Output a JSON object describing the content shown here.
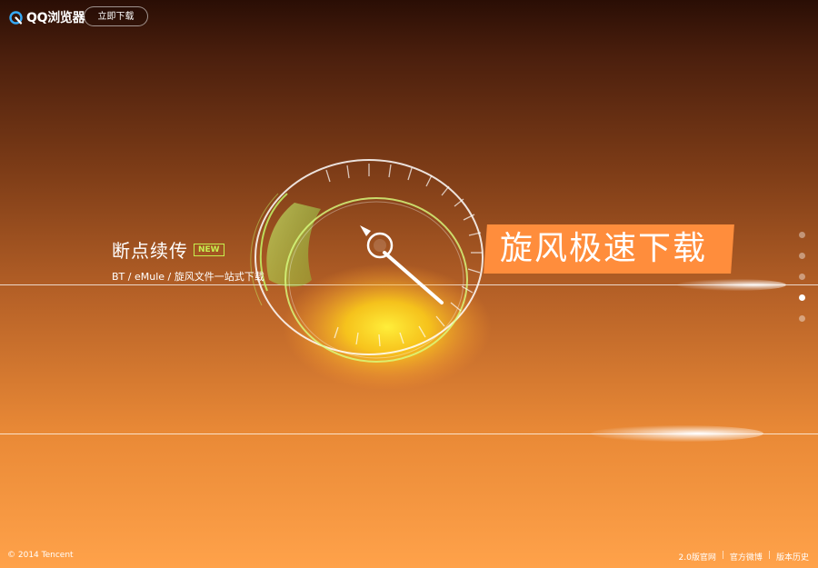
{
  "header": {
    "brand_name": "QQ浏览器",
    "download_button": "立即下载"
  },
  "feature": {
    "title": "断点续传",
    "badge": "NEW",
    "subtitle": "BT / eMule / 旋风文件一站式下载"
  },
  "banner": {
    "text": "旋风极速下载"
  },
  "carousel": {
    "count": 5,
    "active_index": 3
  },
  "footer": {
    "copyright": "© 2014 Tencent",
    "links": [
      "2.0版官网",
      "官方微博",
      "版本历史"
    ]
  },
  "colors": {
    "banner": "#ff8d3c",
    "badge": "#c6ef4e",
    "gauge_glow": "#ffd21a",
    "gauge_green": "#b8f35b"
  },
  "icons": {
    "logo": "qq-browser-logo-icon",
    "speed_gauge": "speedometer-illustration"
  }
}
